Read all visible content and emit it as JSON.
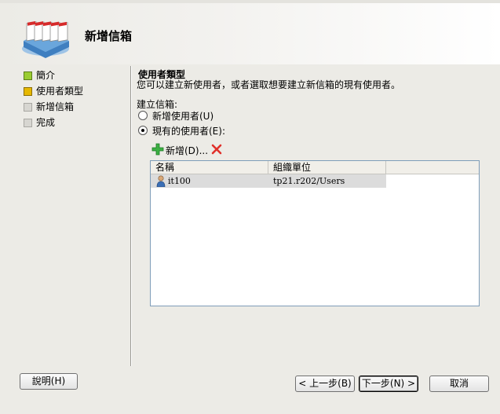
{
  "header": {
    "title": "新增信箱"
  },
  "nav": {
    "items": [
      {
        "label": "簡介",
        "state": "done"
      },
      {
        "label": "使用者類型",
        "state": "current"
      },
      {
        "label": "新增信箱",
        "state": "todo"
      },
      {
        "label": "完成",
        "state": "todo"
      }
    ]
  },
  "main": {
    "section_title": "使用者類型",
    "section_desc": "您可以建立新使用者，或者選取想要建立新信箱的現有使用者。",
    "create_label": "建立信箱:",
    "radio_new": "新增使用者(U)",
    "radio_existing": "現有的使用者(E):",
    "selected_option": "existing",
    "toolbar": {
      "add_label": "新增(D)..."
    },
    "list": {
      "columns": [
        "名稱",
        "組織單位"
      ],
      "rows": [
        {
          "name": "it100",
          "ou": "tp21.r202/Users"
        }
      ]
    }
  },
  "buttons": {
    "help": "說明(H)",
    "back": "< 上一步(B)",
    "next": "下一步(N) >",
    "cancel": "取消"
  },
  "colors": {
    "done": "#9acd32",
    "current": "#e6b800",
    "todo": "#d7d6d1"
  }
}
